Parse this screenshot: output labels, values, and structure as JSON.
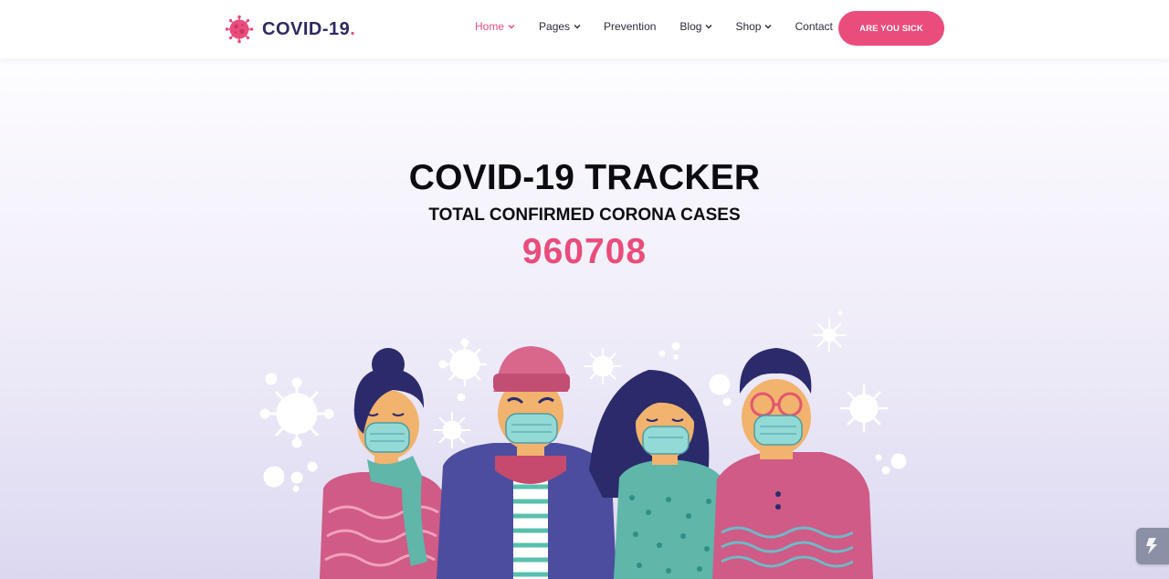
{
  "brand": {
    "name": "COVID-19",
    "dot": "."
  },
  "nav": {
    "home": "Home",
    "pages": "Pages",
    "prevention": "Prevention",
    "blog": "Blog",
    "shop": "Shop",
    "contact": "Contact"
  },
  "cta": {
    "label": "ARE YOU SICK"
  },
  "hero": {
    "title": "COVID-19 TRACKER",
    "subtitle": "TOTAL CONFIRMED CORONA CASES",
    "count": "960708"
  },
  "colors": {
    "accent": "#ea4c7b",
    "brand_text": "#2e2a63",
    "text": "#0c0c10"
  },
  "icons": {
    "logo": "virus-icon",
    "dropdown": "chevron-down-icon",
    "scroll": "lightning-icon"
  }
}
